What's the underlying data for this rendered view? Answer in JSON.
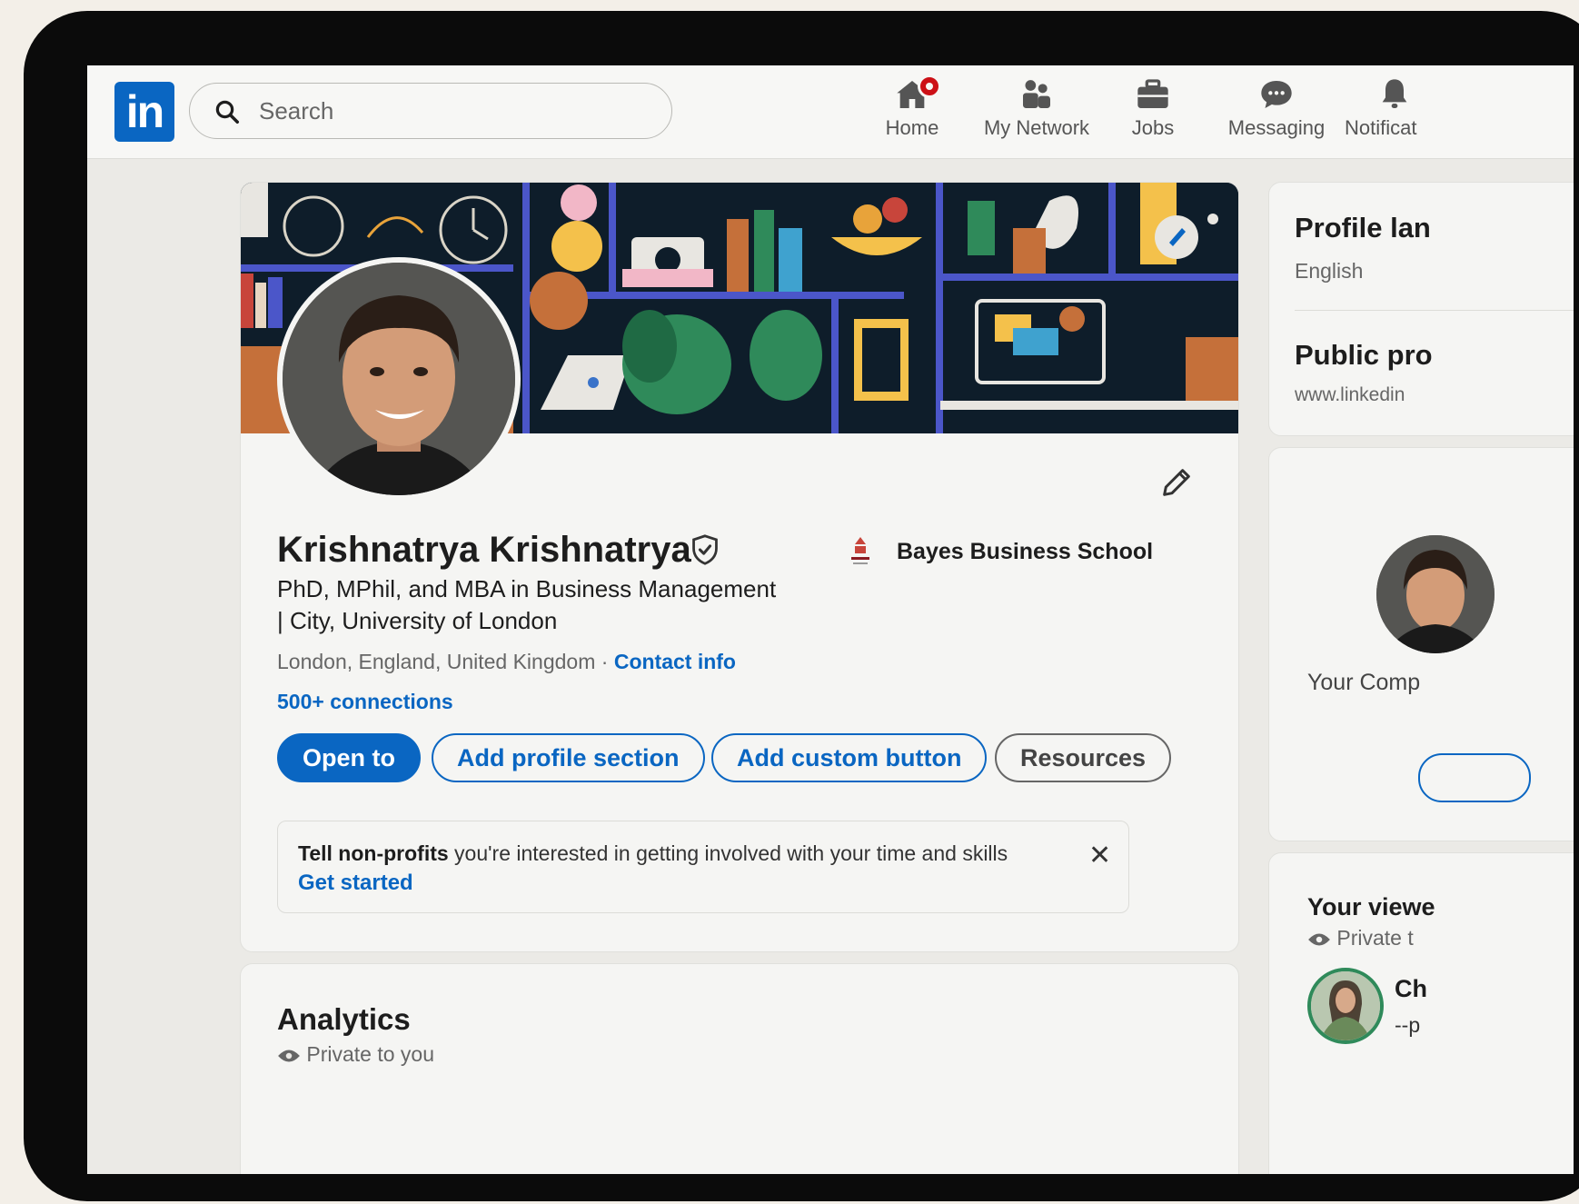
{
  "nav": {
    "logo": "in",
    "search_placeholder": "Search",
    "items": [
      {
        "label": "Home",
        "icon": "home-icon"
      },
      {
        "label": "My Network",
        "icon": "network-icon"
      },
      {
        "label": "Jobs",
        "icon": "briefcase-icon"
      },
      {
        "label": "Messaging",
        "icon": "message-icon"
      },
      {
        "label": "Notificat",
        "icon": "bell-icon"
      }
    ]
  },
  "profile": {
    "name": "Krishnatrya Krishnatrya",
    "school": "Bayes Business School",
    "headline": "PhD, MPhil, and MBA in Business Management | City, University of London",
    "location": "London, England, United Kingdom",
    "separator": " · ",
    "contact_info": "Contact info",
    "connections": "500+ connections",
    "buttons": {
      "open_to": "Open to",
      "add_section": "Add profile section",
      "add_custom": "Add custom button",
      "resources": "Resources"
    },
    "notice": {
      "bold": "Tell non-profits",
      "text": " you're interested in getting involved with your time and skills",
      "action": "Get started",
      "close": "✕"
    }
  },
  "analytics": {
    "title": "Analytics",
    "subtitle": "Private to you"
  },
  "sidebar": {
    "profile_language": {
      "title": "Profile lan",
      "value": "English"
    },
    "public_profile": {
      "title": "Public pro",
      "value": "www.linkedin"
    },
    "company_card": {
      "text": "Your Comp"
    },
    "viewers": {
      "title": "Your viewe",
      "subtitle": "Private t",
      "person_initials": "Ch",
      "person_subtitle": "--p"
    }
  },
  "colors": {
    "brand": "#0a66c2",
    "notification": "#cc1016"
  }
}
